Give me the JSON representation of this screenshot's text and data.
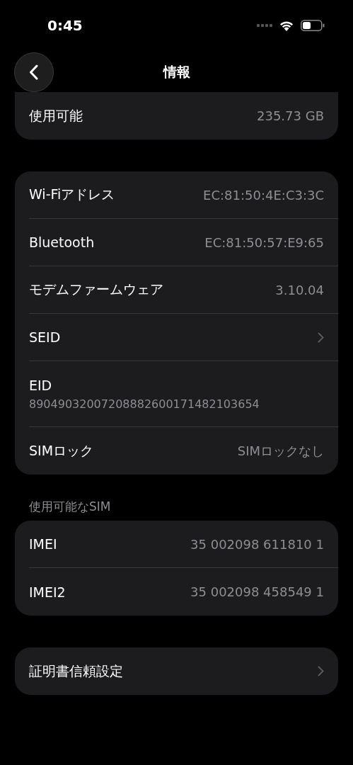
{
  "status_bar": {
    "time": "0:45"
  },
  "nav": {
    "title": "情報"
  },
  "groups": [
    {
      "rows": [
        {
          "kind": "value",
          "label": "使用可能",
          "value": "235.73 GB"
        }
      ]
    },
    {
      "rows": [
        {
          "kind": "value",
          "label": "Wi-Fiアドレス",
          "value": "EC:81:50:4E:C3:3C"
        },
        {
          "kind": "value",
          "label": "Bluetooth",
          "value": "EC:81:50:57:E9:65"
        },
        {
          "kind": "value",
          "label": "モデムファームウェア",
          "value": "3.10.04"
        },
        {
          "kind": "link",
          "label": "SEID"
        },
        {
          "kind": "stacked",
          "label": "EID",
          "value": "89049032007208882600171482103654"
        },
        {
          "kind": "value",
          "label": "SIMロック",
          "value": "SIMロックなし"
        }
      ]
    },
    {
      "header": "使用可能なSIM",
      "rows": [
        {
          "kind": "value",
          "label": "IMEI",
          "value": "35 002098 611810 1"
        },
        {
          "kind": "value",
          "label": "IMEI2",
          "value": "35 002098 458549 1"
        }
      ]
    },
    {
      "rows": [
        {
          "kind": "link",
          "label": "証明書信頼設定"
        }
      ]
    }
  ]
}
